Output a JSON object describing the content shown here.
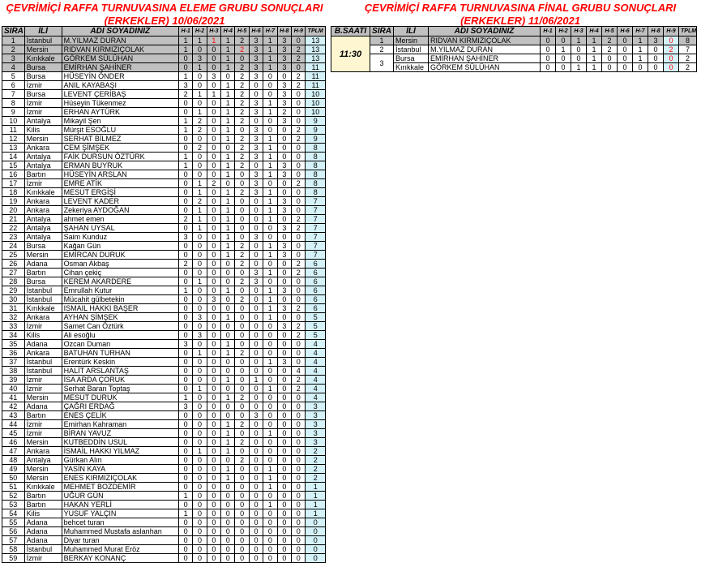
{
  "left": {
    "title_line1": "ÇEVRİMİÇİ RAFFA TURNUVASINA ELEME GRUBU SONUÇLARI",
    "title_line2": "(ERKEKLER)      10/06/2021",
    "headers": [
      "SIRA",
      "İLİ",
      "ADI SOYADINIZ",
      "H-1",
      "H-2",
      "H-3",
      "H-4",
      "H-5",
      "H-6",
      "H-7",
      "H-8",
      "H-9",
      "TPLM"
    ],
    "rows": [
      [
        "1",
        "İstanbul",
        "M.YILMAZ DURAN",
        "1",
        "1",
        "1",
        "1",
        "2",
        "3",
        "1",
        "3",
        "0",
        "13"
      ],
      [
        "2",
        "Mersin",
        "RIDVAN KIRMIZIÇOLAK",
        "1",
        "0",
        "0",
        "1",
        "2",
        "3",
        "1",
        "3",
        "2",
        "13"
      ],
      [
        "3",
        "Kırıkkale",
        "GÖRKEM SÜLÜHAN",
        "0",
        "3",
        "0",
        "1",
        "0",
        "3",
        "1",
        "3",
        "2",
        "13"
      ],
      [
        "4",
        "Bursa",
        "EMİRHAN ŞAHİNER",
        "0",
        "1",
        "0",
        "1",
        "2",
        "3",
        "1",
        "3",
        "0",
        "11"
      ],
      [
        "5",
        "Bursa",
        "HÜSEYİN ÖNDER",
        "1",
        "0",
        "3",
        "0",
        "2",
        "3",
        "0",
        "0",
        "2",
        "11"
      ],
      [
        "6",
        "İzmir",
        "ANIL KAYABAŞI",
        "3",
        "0",
        "0",
        "1",
        "2",
        "0",
        "0",
        "3",
        "2",
        "11"
      ],
      [
        "7",
        "Bursa",
        "LEVENT ÇERİBAŞ",
        "2",
        "1",
        "1",
        "1",
        "2",
        "0",
        "0",
        "3",
        "0",
        "10"
      ],
      [
        "8",
        "İzmir",
        "Hüseyin Tükenmez",
        "0",
        "0",
        "0",
        "1",
        "2",
        "3",
        "1",
        "3",
        "0",
        "10"
      ],
      [
        "9",
        "İzmir",
        "ERHAN AYTÜRK",
        "0",
        "1",
        "0",
        "1",
        "2",
        "3",
        "1",
        "2",
        "0",
        "10"
      ],
      [
        "10",
        "Antalya",
        "Mikayil Şen",
        "1",
        "2",
        "0",
        "1",
        "2",
        "0",
        "0",
        "3",
        "0",
        "9"
      ],
      [
        "11",
        "Kilis",
        "Mürşit ESOĞLU",
        "1",
        "2",
        "0",
        "1",
        "0",
        "3",
        "0",
        "0",
        "2",
        "9"
      ],
      [
        "12",
        "Mersin",
        "SERHAT BİLMEZ",
        "0",
        "0",
        "0",
        "1",
        "2",
        "3",
        "1",
        "0",
        "2",
        "9"
      ],
      [
        "13",
        "Ankara",
        "CEM ŞİMŞEK",
        "0",
        "2",
        "0",
        "0",
        "2",
        "3",
        "1",
        "0",
        "0",
        "8"
      ],
      [
        "14",
        "Antalya",
        "FAİK DURSUN ÖZTÜRK",
        "1",
        "0",
        "0",
        "1",
        "2",
        "3",
        "1",
        "0",
        "0",
        "8"
      ],
      [
        "15",
        "Antalya",
        "ERMAN BUYRUK",
        "1",
        "0",
        "0",
        "1",
        "2",
        "0",
        "1",
        "3",
        "0",
        "8"
      ],
      [
        "16",
        "Bartın",
        "HÜSEYİN ARSLAN",
        "0",
        "0",
        "0",
        "1",
        "0",
        "3",
        "1",
        "3",
        "0",
        "8"
      ],
      [
        "17",
        "İzmir",
        "EMRE ATİK",
        "0",
        "1",
        "2",
        "0",
        "0",
        "3",
        "0",
        "0",
        "2",
        "8"
      ],
      [
        "18",
        "Kırıkkale",
        "MESUT ERGİŞİ",
        "0",
        "1",
        "0",
        "1",
        "2",
        "3",
        "1",
        "0",
        "0",
        "8"
      ],
      [
        "19",
        "Ankara",
        "LEVENT KADER",
        "0",
        "2",
        "0",
        "1",
        "0",
        "0",
        "1",
        "3",
        "0",
        "7"
      ],
      [
        "20",
        "Ankara",
        "Zekeriya AYDOĞAN",
        "0",
        "1",
        "0",
        "1",
        "0",
        "0",
        "1",
        "3",
        "0",
        "7"
      ],
      [
        "21",
        "Antalya",
        "ahmet emen",
        "2",
        "1",
        "0",
        "1",
        "0",
        "0",
        "1",
        "0",
        "2",
        "7"
      ],
      [
        "22",
        "Antalya",
        "ŞAHAN UYSAL",
        "0",
        "1",
        "0",
        "1",
        "0",
        "0",
        "0",
        "3",
        "2",
        "7"
      ],
      [
        "23",
        "Antalya",
        "Saim Kunduz",
        "3",
        "0",
        "0",
        "1",
        "0",
        "3",
        "0",
        "0",
        "0",
        "7"
      ],
      [
        "24",
        "Bursa",
        "Kağan Gün",
        "0",
        "0",
        "0",
        "1",
        "2",
        "0",
        "1",
        "3",
        "0",
        "7"
      ],
      [
        "25",
        "Mersin",
        "EMİRCAN DURUK",
        "0",
        "0",
        "0",
        "1",
        "2",
        "0",
        "1",
        "3",
        "0",
        "7"
      ],
      [
        "26",
        "Adana",
        "Osman Akbaş",
        "2",
        "0",
        "0",
        "0",
        "2",
        "0",
        "0",
        "0",
        "2",
        "6"
      ],
      [
        "27",
        "Bartın",
        "Cihan çekiç",
        "0",
        "0",
        "0",
        "0",
        "0",
        "3",
        "1",
        "0",
        "2",
        "6"
      ],
      [
        "28",
        "Bursa",
        "KEREM AKARDERE",
        "0",
        "1",
        "0",
        "0",
        "2",
        "3",
        "0",
        "0",
        "0",
        "6"
      ],
      [
        "29",
        "İstanbul",
        "Emrullah Kutur",
        "1",
        "0",
        "0",
        "1",
        "0",
        "0",
        "1",
        "3",
        "0",
        "6"
      ],
      [
        "30",
        "İstanbul",
        "Mücahit gülbetekin",
        "0",
        "0",
        "3",
        "0",
        "2",
        "0",
        "1",
        "0",
        "0",
        "6"
      ],
      [
        "31",
        "Kırıkkale",
        "ISMAIL HAKKI BAŞER",
        "0",
        "0",
        "0",
        "0",
        "0",
        "0",
        "1",
        "3",
        "2",
        "6"
      ],
      [
        "32",
        "Ankara",
        "AYHAN ŞİMŞEK",
        "0",
        "3",
        "0",
        "1",
        "0",
        "0",
        "1",
        "0",
        "0",
        "5"
      ],
      [
        "33",
        "İzmir",
        "Samet Can Öztürk",
        "0",
        "0",
        "0",
        "0",
        "0",
        "0",
        "0",
        "3",
        "2",
        "5"
      ],
      [
        "34",
        "Kilis",
        "Ali esoğlu",
        "0",
        "3",
        "0",
        "0",
        "0",
        "0",
        "0",
        "0",
        "2",
        "5"
      ],
      [
        "35",
        "Adana",
        "Ozcan Duman",
        "3",
        "0",
        "0",
        "1",
        "0",
        "0",
        "0",
        "0",
        "0",
        "4"
      ],
      [
        "36",
        "Ankara",
        "BATUHAN TURHAN",
        "0",
        "1",
        "0",
        "1",
        "2",
        "0",
        "0",
        "0",
        "0",
        "4"
      ],
      [
        "37",
        "İstanbul",
        "Erentürk Keskin",
        "0",
        "0",
        "0",
        "0",
        "0",
        "0",
        "1",
        "3",
        "0",
        "4"
      ],
      [
        "38",
        "İstanbul",
        "HALİT ARSLANTAŞ",
        "0",
        "0",
        "0",
        "0",
        "0",
        "0",
        "0",
        "0",
        "4",
        "4"
      ],
      [
        "39",
        "İzmir",
        "İSA ARDA ÇORUK",
        "0",
        "0",
        "0",
        "1",
        "0",
        "1",
        "0",
        "0",
        "2",
        "4"
      ],
      [
        "40",
        "İzmir",
        "Serhat Baran Toptaş",
        "0",
        "1",
        "0",
        "0",
        "0",
        "0",
        "1",
        "0",
        "2",
        "4"
      ],
      [
        "41",
        "Mersin",
        "MESUT DURUK",
        "1",
        "0",
        "0",
        "1",
        "2",
        "0",
        "0",
        "0",
        "0",
        "4"
      ],
      [
        "42",
        "Adana",
        "ÇAĞRI ERDAĞ",
        "3",
        "0",
        "0",
        "0",
        "0",
        "0",
        "0",
        "0",
        "0",
        "3"
      ],
      [
        "43",
        "Bartın",
        "ENES ÇELİK",
        "0",
        "0",
        "0",
        "0",
        "0",
        "3",
        "0",
        "0",
        "0",
        "3"
      ],
      [
        "44",
        "İzmir",
        "Emirhan Kahraman",
        "0",
        "0",
        "0",
        "1",
        "2",
        "0",
        "0",
        "0",
        "0",
        "3"
      ],
      [
        "45",
        "İzmir",
        "BİRAN YAVUZ",
        "0",
        "0",
        "0",
        "1",
        "0",
        "0",
        "1",
        "0",
        "0",
        "3"
      ],
      [
        "46",
        "Mersin",
        "KUTBEDDİN USUL",
        "0",
        "0",
        "0",
        "1",
        "2",
        "0",
        "0",
        "0",
        "0",
        "3"
      ],
      [
        "47",
        "Ankara",
        "İSMAİL HAKKI YILMAZ",
        "0",
        "1",
        "0",
        "1",
        "0",
        "0",
        "0",
        "0",
        "0",
        "2"
      ],
      [
        "48",
        "Antalya",
        "Gürkan Alın",
        "0",
        "0",
        "0",
        "0",
        "2",
        "0",
        "0",
        "0",
        "0",
        "2"
      ],
      [
        "49",
        "Mersin",
        "YASİN KAYA",
        "0",
        "0",
        "0",
        "1",
        "0",
        "0",
        "1",
        "0",
        "0",
        "2"
      ],
      [
        "50",
        "Mersin",
        "ENES KIRMIZIÇOLAK",
        "0",
        "0",
        "0",
        "1",
        "0",
        "0",
        "1",
        "0",
        "0",
        "2"
      ],
      [
        "51",
        "Kırıkkale",
        "MEHMET BOZDEMİR",
        "0",
        "0",
        "0",
        "0",
        "0",
        "0",
        "1",
        "0",
        "0",
        "1"
      ],
      [
        "52",
        "Bartın",
        "UĞUR GÜN",
        "1",
        "0",
        "0",
        "0",
        "0",
        "0",
        "0",
        "0",
        "0",
        "1"
      ],
      [
        "53",
        "Bartın",
        "HAKAN YERLİ",
        "0",
        "0",
        "0",
        "0",
        "0",
        "0",
        "1",
        "0",
        "0",
        "1"
      ],
      [
        "54",
        "Kilis",
        "YUSUF YALÇIN",
        "1",
        "0",
        "0",
        "0",
        "0",
        "0",
        "0",
        "0",
        "0",
        "1"
      ],
      [
        "55",
        "Adana",
        "behcet turan",
        "0",
        "0",
        "0",
        "0",
        "0",
        "0",
        "0",
        "0",
        "0",
        "0"
      ],
      [
        "56",
        "Adana",
        "Muhammed Mustafa aslanhan",
        "0",
        "0",
        "0",
        "0",
        "0",
        "0",
        "0",
        "0",
        "0",
        "0"
      ],
      [
        "57",
        "Adana",
        "Diyar turan",
        "0",
        "0",
        "0",
        "0",
        "0",
        "0",
        "0",
        "0",
        "0",
        "0"
      ],
      [
        "58",
        "İstanbul",
        "Muhammed Murat Eröz",
        "0",
        "0",
        "0",
        "0",
        "0",
        "0",
        "0",
        "0",
        "0",
        "0"
      ],
      [
        "59",
        "İzmir",
        "BERKAY KONANÇ",
        "0",
        "0",
        "0",
        "0",
        "0",
        "0",
        "0",
        "0",
        "0",
        "0"
      ]
    ]
  },
  "right": {
    "title_line1": "ÇEVRİMİÇİ RAFFA TURNUVASINA FİNAL GRUBU SONUÇLARI",
    "title_line2": "(ERKEKLER)      11/06/2021",
    "headers": [
      "B.SAATİ",
      "SIRA",
      "İLİ",
      "ADI SOYADINIZ",
      "H-1",
      "H-2",
      "H-3",
      "H-4",
      "H-5",
      "H-6",
      "H-7",
      "H-8",
      "H-9",
      "TPLM"
    ],
    "saat": "11:30",
    "rows": [
      [
        "1",
        "Mersin",
        "RIDVAN KIRMIZIÇOLAK",
        "0",
        "0",
        "1",
        "1",
        "2",
        "0",
        "1",
        "3",
        "0",
        "8"
      ],
      [
        "2",
        "İstanbul",
        "M.YILMAZ DURAN",
        "0",
        "1",
        "0",
        "1",
        "2",
        "0",
        "1",
        "0",
        "2",
        "7"
      ],
      [
        "3",
        "Bursa",
        "EMİRHAN ŞAHİNER",
        "0",
        "0",
        "0",
        "1",
        "0",
        "0",
        "1",
        "0",
        "0",
        "2"
      ],
      [
        "",
        "Kırıkkale",
        "GÖRKEM SÜLÜHAN",
        "0",
        "0",
        "1",
        "1",
        "0",
        "0",
        "0",
        "0",
        "0",
        "2"
      ]
    ]
  }
}
